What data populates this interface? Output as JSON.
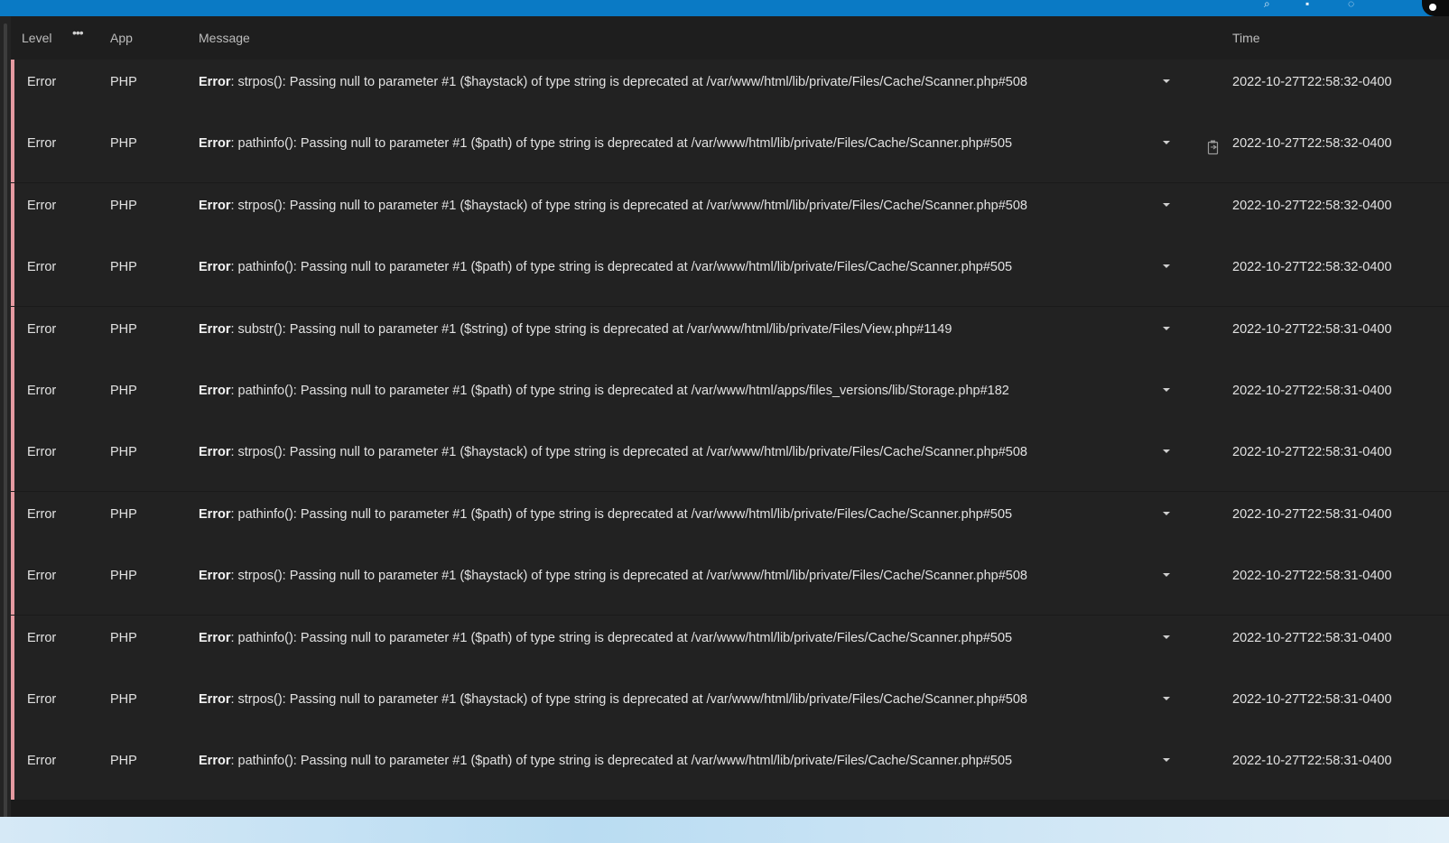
{
  "colors": {
    "topbar": "#0a7ac5",
    "error_stripe": "#e59aa1",
    "row_bg": "#222222",
    "header_bg": "#1e1e1e"
  },
  "icons": {
    "more": "more-horizontal-icon",
    "expand": "chevron-down-icon",
    "copy": "clipboard-copy-icon"
  },
  "header": {
    "level": "Level",
    "more": "•••",
    "app": "App",
    "message": "Message",
    "time": "Time"
  },
  "rows": [
    {
      "level": "Error",
      "app": "PHP",
      "msg_prefix": "Error",
      "msg_text": ": strpos(): Passing null to parameter #1 ($haystack) of type string is deprecated at /var/www/html/lib/private/Files/Cache/Scanner.php#508",
      "time": "2022-10-27T22:58:32-0400"
    },
    {
      "level": "Error",
      "app": "PHP",
      "msg_prefix": "Error",
      "msg_text": ": pathinfo(): Passing null to parameter #1 ($path) of type string is deprecated at /var/www/html/lib/private/Files/Cache/Scanner.php#505",
      "time": "2022-10-27T22:58:32-0400"
    },
    {
      "level": "Error",
      "app": "PHP",
      "msg_prefix": "Error",
      "msg_text": ": strpos(): Passing null to parameter #1 ($haystack) of type string is deprecated at /var/www/html/lib/private/Files/Cache/Scanner.php#508",
      "time": "2022-10-27T22:58:32-0400"
    },
    {
      "level": "Error",
      "app": "PHP",
      "msg_prefix": "Error",
      "msg_text": ": pathinfo(): Passing null to parameter #1 ($path) of type string is deprecated at /var/www/html/lib/private/Files/Cache/Scanner.php#505",
      "time": "2022-10-27T22:58:32-0400"
    },
    {
      "level": "Error",
      "app": "PHP",
      "msg_prefix": "Error",
      "msg_text": ": substr(): Passing null to parameter #1 ($string) of type string is deprecated at /var/www/html/lib/private/Files/View.php#1149",
      "time": "2022-10-27T22:58:31-0400"
    },
    {
      "level": "Error",
      "app": "PHP",
      "msg_prefix": "Error",
      "msg_text": ": pathinfo(): Passing null to parameter #1 ($path) of type string is deprecated at /var/www/html/apps/files_versions/lib/Storage.php#182",
      "time": "2022-10-27T22:58:31-0400"
    },
    {
      "level": "Error",
      "app": "PHP",
      "msg_prefix": "Error",
      "msg_text": ": strpos(): Passing null to parameter #1 ($haystack) of type string is deprecated at /var/www/html/lib/private/Files/Cache/Scanner.php#508",
      "time": "2022-10-27T22:58:31-0400"
    },
    {
      "level": "Error",
      "app": "PHP",
      "msg_prefix": "Error",
      "msg_text": ": pathinfo(): Passing null to parameter #1 ($path) of type string is deprecated at /var/www/html/lib/private/Files/Cache/Scanner.php#505",
      "time": "2022-10-27T22:58:31-0400"
    },
    {
      "level": "Error",
      "app": "PHP",
      "msg_prefix": "Error",
      "msg_text": ": strpos(): Passing null to parameter #1 ($haystack) of type string is deprecated at /var/www/html/lib/private/Files/Cache/Scanner.php#508",
      "time": "2022-10-27T22:58:31-0400"
    },
    {
      "level": "Error",
      "app": "PHP",
      "msg_prefix": "Error",
      "msg_text": ": pathinfo(): Passing null to parameter #1 ($path) of type string is deprecated at /var/www/html/lib/private/Files/Cache/Scanner.php#505",
      "time": "2022-10-27T22:58:31-0400"
    },
    {
      "level": "Error",
      "app": "PHP",
      "msg_prefix": "Error",
      "msg_text": ": strpos(): Passing null to parameter #1 ($haystack) of type string is deprecated at /var/www/html/lib/private/Files/Cache/Scanner.php#508",
      "time": "2022-10-27T22:58:31-0400"
    },
    {
      "level": "Error",
      "app": "PHP",
      "msg_prefix": "Error",
      "msg_text": ": pathinfo(): Passing null to parameter #1 ($path) of type string is deprecated at /var/www/html/lib/private/Files/Cache/Scanner.php#505",
      "time": "2022-10-27T22:58:31-0400"
    }
  ]
}
